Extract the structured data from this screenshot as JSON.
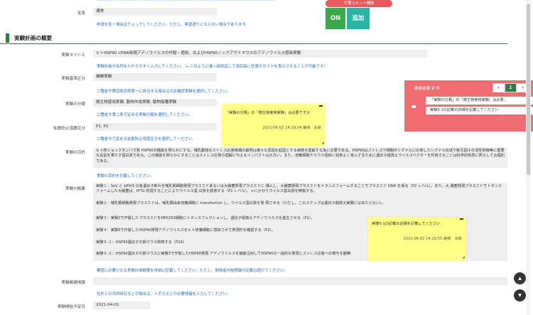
{
  "top": {
    "cut_line": "……………………………………………………………………………………………………………………………………",
    "urgent_label": "至急",
    "urgent_value": "通常",
    "urgent_hint": "申請を急ぐ場合はチェックしてください。ただし、希望通りにならない場合があります。"
  },
  "floating_comment": {
    "title": "付箋コメント機能",
    "on_label": "ON",
    "add_label": "追加"
  },
  "section": {
    "title": "実験計画の概要"
  },
  "fields": {
    "title_label": "実験タイトル",
    "title_value": "ヒトHSP90 cDNA発現アデノウイルスの作製・使用、およびHSP90ノックアウトマウスのアデノウイルス感染実験",
    "title_hint": "実験計画の名称をわかりやすく入力してください。（←このように導入時設定にて項目毎に任意のガイドを表示させることが可能です）",
    "basis_label": "実験基準区分",
    "basis_value": "機関実験",
    "basis_hint": "二種省令第四条別表第一に該当する場合は大臣確認実験を選択してください。",
    "category_label": "実験の分類",
    "category_value": "微生物使用実験, 動物作成実験, 動物接種実験",
    "category_hint": "二種省令第二条で定める実験分類を選択してください。",
    "containment_label": "拡散防止措置区分",
    "containment_value": "P1, P2",
    "containment_hint": "二種省令で定める拡散防止措置区分を選択してください。",
    "purpose_label": "実験の目的",
    "purpose_text": "ヒト熱ショックタンパク質 HSP90の機能を明らかにする。哺乳動物のストレス応答機構の解明は様々な原因を起因とする病態を理解する為に必要である。HSP90はストレスや細胞外シグナルに応答したシグナル伝達や転写因子の活性制御等に重要な役割を果たす蛋白質である。この機能を明らかにすることはストレス応答の理解に与えるインパクトは大きい。また、培養細胞やマウス個体に効率よく導入するために遺伝子組換えウイルスベクターを利用することは科学的知見に照らして合理的である。",
    "purpose_hint": "実験の目的を記載してください。",
    "overview_label": "実験の概要",
    "overview_lines": [
      "実験１：SeV と bPIV3 の各遺伝子断片を哺乳類細胞発現プラスミドあるいは大腸菌発現プラスミドに 挿入し、大腸菌発現プラスミドをトランスフォームすることでプラスミド DNA を得る（P2 レベル）。また、大 腸菌発現プラスミドでトランスフォームした大腸菌は、IPTG 処理することによりウイルス蛋 白質を誘導する（P2 レベル）。ｅにかかりウイルス蛋白質を精製する。",
      "実験２：哺乳類細胞発現プラスミドは、哺乳類由来培養細胞に transfection し、ウイルス蛋白質を発 現させる（ただし、このステップは遺伝子組換え実験にはあたらない）。",
      "実験３：実験2で作製したプラスミドをHEK293細胞にトランスフェクションし、遺伝子組換えアデノウイルスを産生させる（P2）。",
      "実験４：実験3で作製したHSP90発現アデノウイルスをヒト培養細胞に感染させて表現形を確認する（P2）。",
      "実験５-１：HSP90遺伝子欠損マウス飼育する（P1A）",
      "実験５-２：HSP90遺伝子欠損マウスに実験3で作製したHSP90発現 アデノウイルスを静脈注射してHSP90の一過的な発現とストレス応答への寄与を観察"
    ],
    "overview_hint": "審査に必要となる実験計画概要を詳細に記載してください。ただし、関係者内秘情報の記載は避けてください。",
    "related_label": "実験関連情報",
    "related_hint": "社外との共同研究などの場合は、入手元などの必要情報を入力してください。",
    "start_label": "実験開始予定日",
    "start_value": "2021-04-01"
  },
  "notes": [
    {
      "text": "「実験の分類」の「微生物使用実験」は必要ですか",
      "date": "2021-06-02 14:29:04 嵯峨　太郎"
    },
    {
      "text": "実験5-1の記載の詳細を記載してください",
      "date": "2021-06-02 14:29:55 嵯峨　太郎"
    }
  ],
  "search": {
    "title": "検索結果",
    "count": "2",
    "unit": "件",
    "pager_prev": "«",
    "pager_current": "1",
    "pager_next": "»",
    "results": [
      "「実験の分類」の「微生物使用実験」は必要…",
      "実験5-1の記載の詳細を記載してください"
    ]
  },
  "scroll": {
    "up_icon": "▲",
    "down_icon": "▼"
  }
}
